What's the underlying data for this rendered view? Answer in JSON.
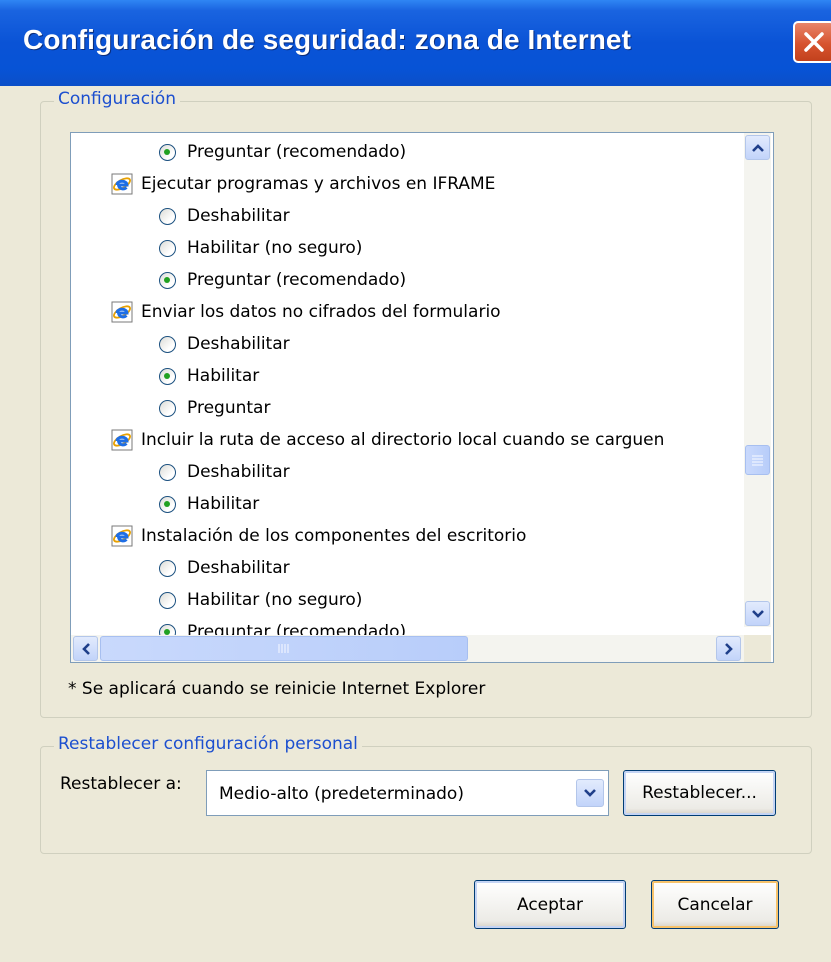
{
  "window": {
    "title": "Configuración de seguridad: zona de Internet"
  },
  "settings_group": {
    "label": "Configuración",
    "items": [
      {
        "kind": "radio",
        "label": "Preguntar (recomendado)",
        "checked": true
      },
      {
        "kind": "header",
        "label": "Ejecutar programas y archivos en IFRAME",
        "icon": "ie-icon"
      },
      {
        "kind": "radio",
        "label": "Deshabilitar",
        "checked": false
      },
      {
        "kind": "radio",
        "label": "Habilitar (no seguro)",
        "checked": false
      },
      {
        "kind": "radio",
        "label": "Preguntar (recomendado)",
        "checked": true
      },
      {
        "kind": "header",
        "label": "Enviar los datos no cifrados del formulario",
        "icon": "ie-icon"
      },
      {
        "kind": "radio",
        "label": "Deshabilitar",
        "checked": false
      },
      {
        "kind": "radio",
        "label": "Habilitar",
        "checked": true
      },
      {
        "kind": "radio",
        "label": "Preguntar",
        "checked": false
      },
      {
        "kind": "header",
        "label": "Incluir la ruta de acceso al directorio local cuando se carguen",
        "icon": "ie-icon"
      },
      {
        "kind": "radio",
        "label": "Deshabilitar",
        "checked": false
      },
      {
        "kind": "radio",
        "label": "Habilitar",
        "checked": true
      },
      {
        "kind": "header",
        "label": "Instalación de los componentes del escritorio",
        "icon": "ie-icon"
      },
      {
        "kind": "radio",
        "label": "Deshabilitar",
        "checked": false
      },
      {
        "kind": "radio",
        "label": "Habilitar (no seguro)",
        "checked": false
      },
      {
        "kind": "radio",
        "label": "Preguntar (recomendado)",
        "checked": true
      }
    ],
    "note": "* Se aplicará cuando se reinicie Internet Explorer"
  },
  "reset_group": {
    "label": "Restablecer configuración personal",
    "reset_to_label": "Restablecer a:",
    "selected_level": "Medio-alto (predeterminado)",
    "reset_button": "Restablecer..."
  },
  "footer": {
    "ok": "Aceptar",
    "cancel": "Cancelar"
  },
  "colors": {
    "title_bar": "#0a53d6",
    "group_label": "#1c4fcf",
    "dialog_bg": "#ece9d8",
    "radio_dot": "#21a121"
  }
}
